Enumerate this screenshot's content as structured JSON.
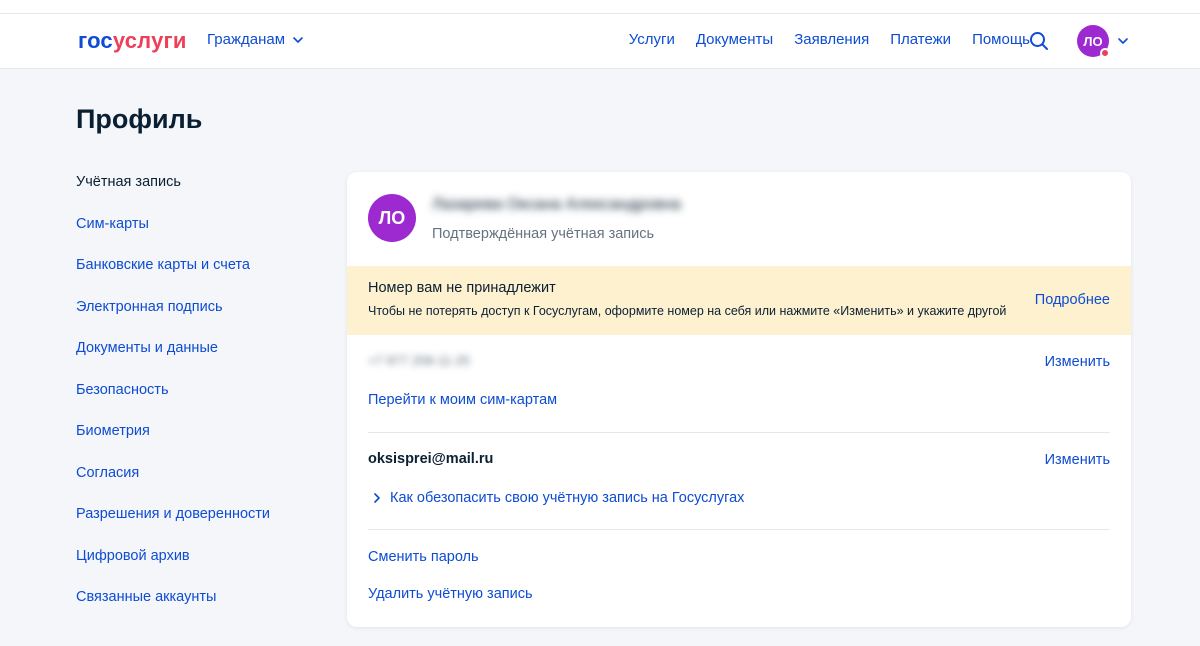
{
  "header": {
    "logo_part1": "гос",
    "logo_part2": "услуги",
    "audience_label": "Гражданам",
    "nav": [
      "Услуги",
      "Документы",
      "Заявления",
      "Платежи",
      "Помощь"
    ],
    "avatar_initials": "ЛО"
  },
  "page": {
    "title": "Профиль"
  },
  "sidebar": {
    "items": [
      {
        "label": "Учётная запись",
        "active": true
      },
      {
        "label": "Сим-карты"
      },
      {
        "label": "Банковские карты и счета"
      },
      {
        "label": "Электронная подпись"
      },
      {
        "label": "Документы и данные"
      },
      {
        "label": "Безопасность"
      },
      {
        "label": "Биометрия"
      },
      {
        "label": "Согласия"
      },
      {
        "label": "Разрешения и доверенности"
      },
      {
        "label": "Цифровой архив"
      },
      {
        "label": "Связанные аккаунты"
      }
    ]
  },
  "profile": {
    "initials": "ЛО",
    "full_name": "Лазарева Оксана Александровна",
    "status": "Подтверждённая учётная запись"
  },
  "warning": {
    "title": "Номер вам не принадлежит",
    "description": "Чтобы не потерять доступ к Госуслугам, оформите номер на себя или нажмите «Изменить» и укажите другой",
    "more_label": "Подробнее"
  },
  "phone": {
    "value": "+7 977 258-11-25",
    "change_label": "Изменить",
    "sim_link": "Перейти к моим сим-картам"
  },
  "email": {
    "value": "oksisprei@mail.ru",
    "change_label": "Изменить",
    "tip_link": "Как обезопасить свою учётную запись на Госуслугах"
  },
  "actions": {
    "change_password": "Сменить пароль",
    "delete_account": "Удалить учётную запись"
  },
  "colors": {
    "brand_blue": "#0d4cd3",
    "brand_red": "#ee3f58",
    "avatar_purple": "#9d29d1",
    "warning_bg": "#fdf1cf"
  }
}
